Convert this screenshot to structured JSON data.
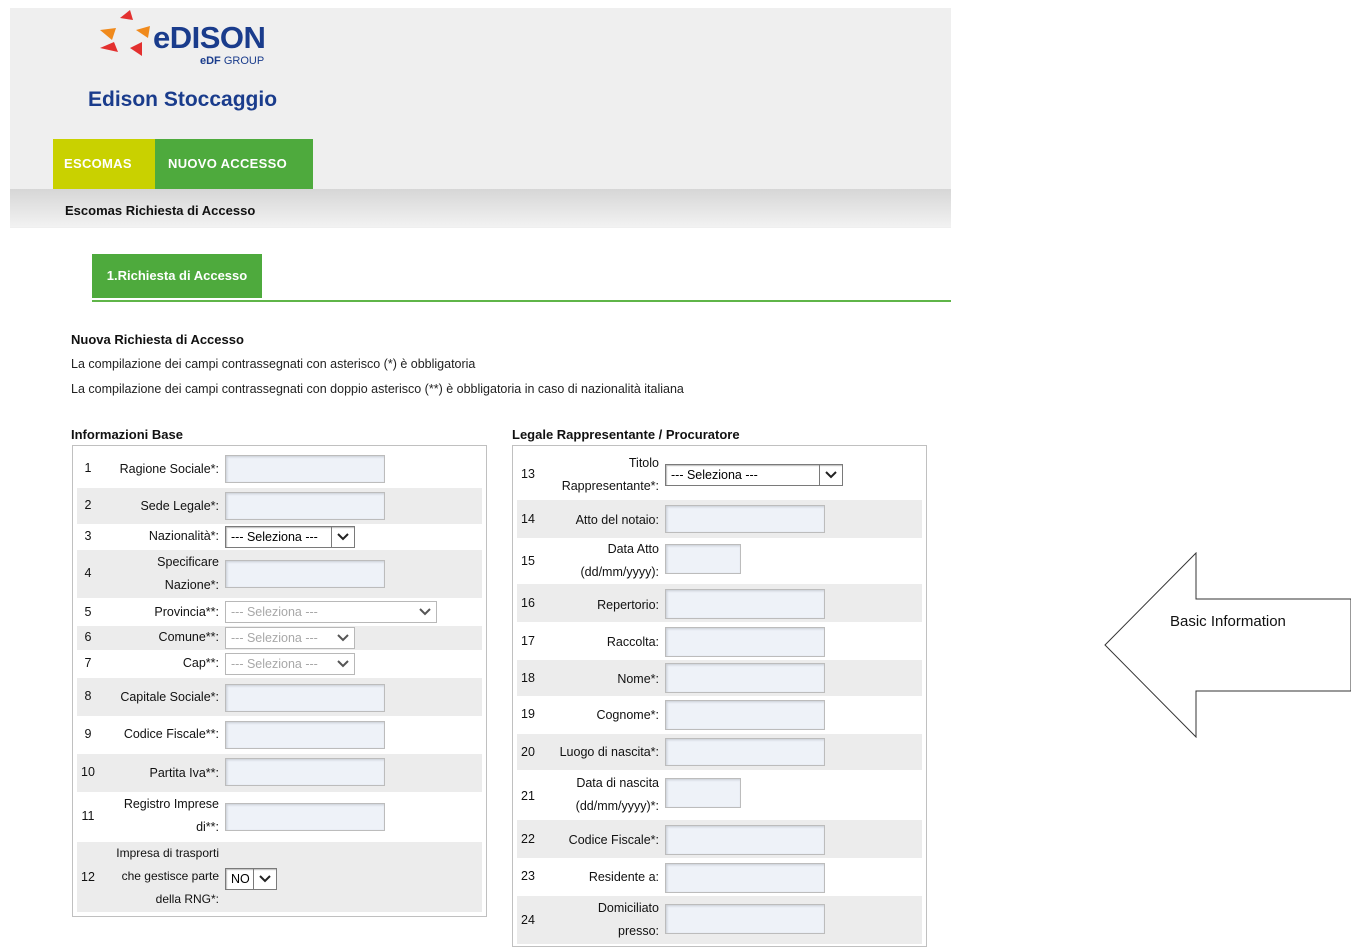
{
  "brand": {
    "name": "eDISON",
    "group_prefix": "eDF",
    "group_suffix": "GROUP",
    "title": "Edison Stoccaggio",
    "colors": {
      "blue": "#1a3c8c",
      "red": "#e3302f",
      "yellow": "#c9d100",
      "green": "#4eaa3d"
    }
  },
  "nav": {
    "tabs": [
      {
        "label": "ESCOMAS"
      },
      {
        "label": "NUOVO ACCESSO"
      }
    ]
  },
  "subheader": "Escomas Richiesta di Accesso",
  "step_tab": "1.Richiesta di Accesso",
  "intro": {
    "title": "Nuova Richiesta di Accesso",
    "line1": "La compilazione dei campi contrassegnati con asterisco (*) è obbligatoria",
    "line2": "La compilazione dei campi contrassegnati con doppio asterisco (**) è obbligatoria in caso di nazionalità italiana"
  },
  "sections": {
    "base": "Informazioni Base",
    "legal": "Legale Rappresentante / Procuratore"
  },
  "base_fields": [
    {
      "num": "1",
      "label": "Ragione Sociale*:"
    },
    {
      "num": "2",
      "label": "Sede Legale*:"
    },
    {
      "num": "3",
      "label": "Nazionalità*:",
      "select": "--- Seleziona ---"
    },
    {
      "num": "4",
      "label1": "Specificare",
      "label2": "Nazione*:"
    },
    {
      "num": "5",
      "label": "Provincia**:",
      "select": "--- Seleziona ---"
    },
    {
      "num": "6",
      "label": "Comune**:",
      "select": "--- Seleziona ---"
    },
    {
      "num": "7",
      "label": "Cap**:",
      "select": "--- Seleziona ---"
    },
    {
      "num": "8",
      "label": "Capitale Sociale*:"
    },
    {
      "num": "9",
      "label": "Codice Fiscale**:"
    },
    {
      "num": "10",
      "label": "Partita Iva**:"
    },
    {
      "num": "11",
      "label1": "Registro Imprese",
      "label2": "di**:"
    },
    {
      "num": "12",
      "label1": "Impresa di trasporti",
      "label2": "che gestisce parte",
      "label3": "della RNG*:",
      "select": "NO"
    }
  ],
  "legal_fields": [
    {
      "num": "13",
      "label1": "Titolo",
      "label2": "Rappresentante*:",
      "select": "--- Seleziona ---"
    },
    {
      "num": "14",
      "label": "Atto del notaio:"
    },
    {
      "num": "15",
      "label1": "Data Atto",
      "label2": "(dd/mm/yyyy):"
    },
    {
      "num": "16",
      "label": "Repertorio:"
    },
    {
      "num": "17",
      "label": "Raccolta:"
    },
    {
      "num": "18",
      "label": "Nome*:"
    },
    {
      "num": "19",
      "label": "Cognome*:"
    },
    {
      "num": "20",
      "label": "Luogo di nascita*:"
    },
    {
      "num": "21",
      "label1": "Data di nascita",
      "label2": "(dd/mm/yyyy)*:"
    },
    {
      "num": "22",
      "label": "Codice Fiscale*:"
    },
    {
      "num": "23",
      "label": "Residente a:"
    },
    {
      "num": "24",
      "label1": "Domiciliato",
      "label2": "presso:"
    }
  ],
  "annotation": {
    "label": "Basic Information"
  }
}
